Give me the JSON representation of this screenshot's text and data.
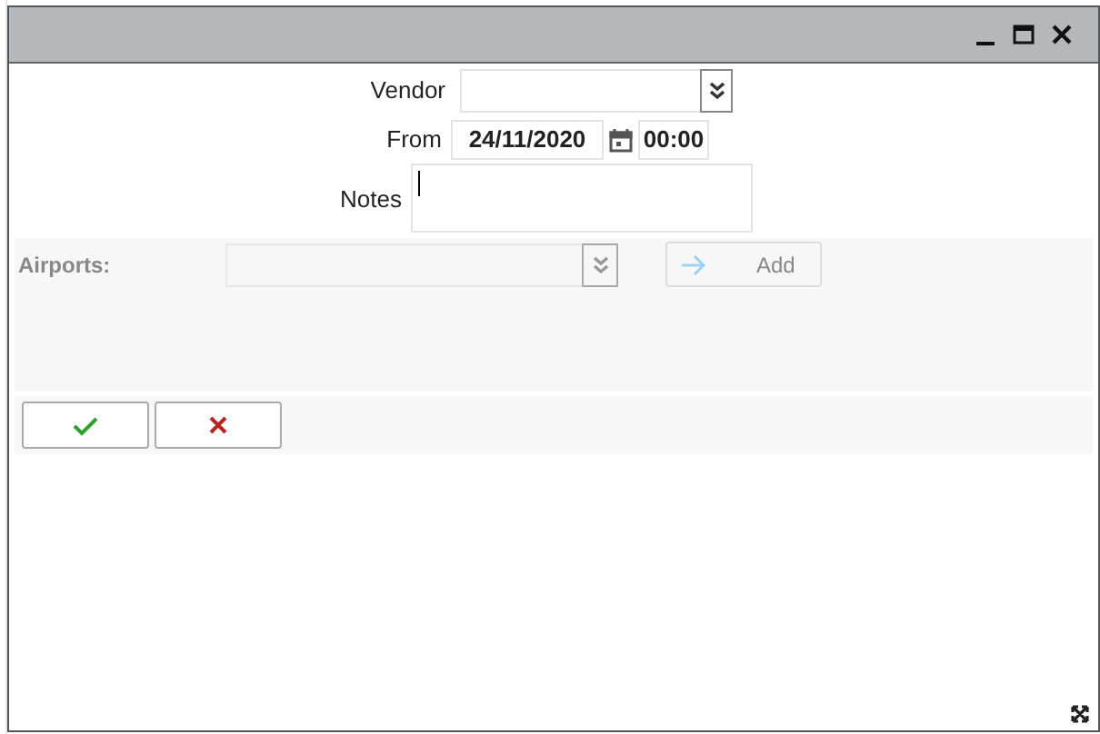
{
  "window": {
    "controls": [
      {
        "kind": "minimize"
      },
      {
        "kind": "maximize"
      },
      {
        "kind": "close"
      }
    ]
  },
  "form": {
    "vendor": {
      "label": "Vendor"
    },
    "from": {
      "label": "From",
      "date": "24/11/2020",
      "time": "00:00"
    },
    "notes": {
      "label": "Notes",
      "focused": true
    }
  },
  "airports": {
    "label": "Airports:",
    "disabled": true,
    "add_button": {
      "label": "Add",
      "disabled": true
    }
  },
  "actions": [
    {
      "kind": "confirm"
    },
    {
      "kind": "cancel"
    }
  ]
}
